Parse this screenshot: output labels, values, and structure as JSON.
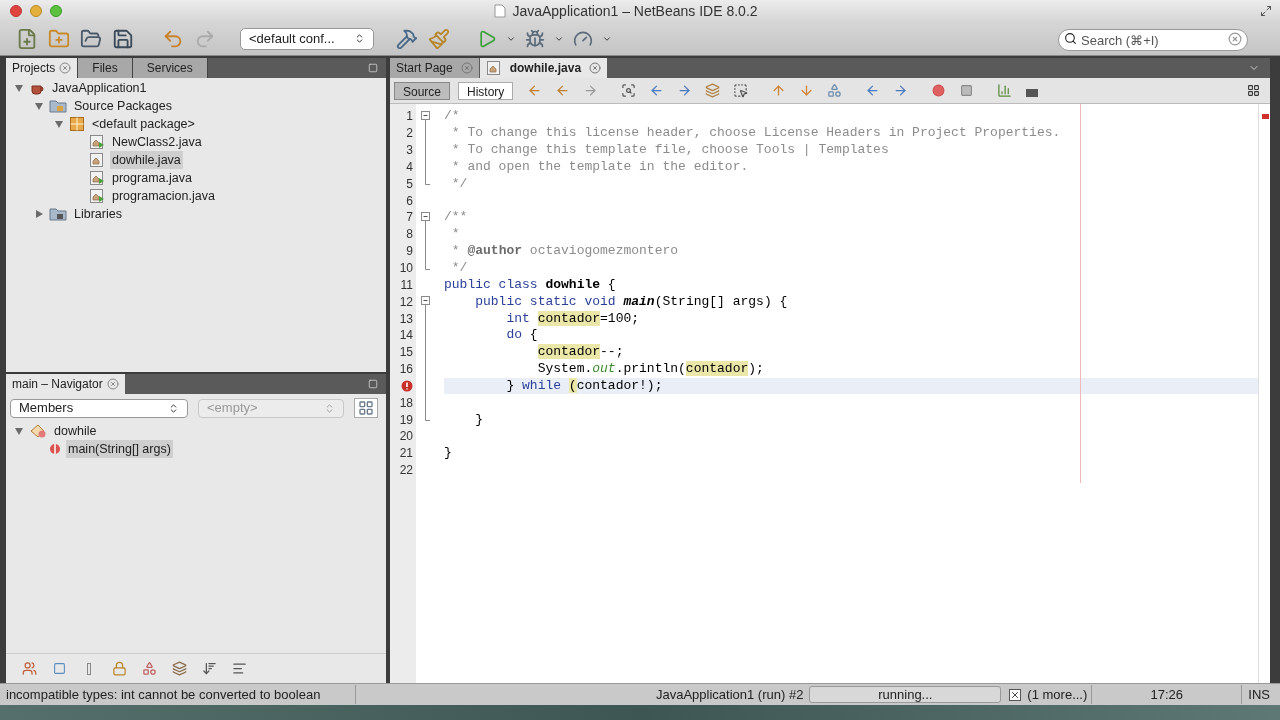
{
  "window": {
    "title": "JavaApplication1 – NetBeans IDE 8.0.2"
  },
  "toolbar": {
    "configuration": "<default conf...",
    "search": {
      "placeholder": "Search (⌘+I)"
    }
  },
  "projects": {
    "tabs": [
      {
        "label": "Projects",
        "selected": true,
        "closable": true
      },
      {
        "label": "Files",
        "selected": false,
        "closable": false
      },
      {
        "label": "Services",
        "selected": false,
        "closable": false
      }
    ],
    "tree": [
      {
        "label": "JavaApplication1",
        "kind": "project",
        "expanded": true,
        "selected": false,
        "children": [
          {
            "label": "Source Packages",
            "kind": "source",
            "expanded": true,
            "selected": false,
            "children": [
              {
                "label": "<default package>",
                "kind": "package",
                "expanded": true,
                "selected": false,
                "children": [
                  {
                    "label": "NewClass2.java",
                    "kind": "runnable",
                    "selected": false
                  },
                  {
                    "label": "dowhile.java",
                    "kind": "file",
                    "selected": true
                  },
                  {
                    "label": "programa.java",
                    "kind": "runnable",
                    "selected": false
                  },
                  {
                    "label": "programacion.java",
                    "kind": "runnable",
                    "selected": false
                  }
                ]
              }
            ]
          },
          {
            "label": "Libraries",
            "kind": "libraries",
            "expanded": false,
            "selected": false
          }
        ]
      }
    ]
  },
  "navigator": {
    "title": "main – Navigator",
    "filters": [
      {
        "label": "Members",
        "disabled": false
      },
      {
        "label": "<empty>",
        "disabled": true
      }
    ],
    "tree": [
      {
        "label": "dowhile",
        "kind": "class",
        "expanded": true,
        "selected": false,
        "children": [
          {
            "label": "main(String[] args)",
            "kind": "method",
            "selected": true
          }
        ]
      }
    ]
  },
  "editor": {
    "tabs": [
      {
        "label": "Start Page",
        "selected": false
      },
      {
        "label": "dowhile.java",
        "selected": true
      }
    ],
    "views": [
      {
        "label": "Source",
        "selected": true
      },
      {
        "label": "History",
        "selected": false
      }
    ],
    "lines": [
      {
        "number": "1",
        "kind": "start",
        "error": false,
        "current": false,
        "tokens": [
          {
            "kind": "comment",
            "text": "/*"
          }
        ]
      },
      {
        "number": "2",
        "kind": "body",
        "error": false,
        "current": false,
        "tokens": [
          {
            "kind": "comment",
            "text": " * To change this license header, choose License Headers in Project Properties."
          }
        ]
      },
      {
        "number": "3",
        "kind": "body",
        "error": false,
        "current": false,
        "tokens": [
          {
            "kind": "comment",
            "text": " * To change this template file, choose Tools | Templates"
          }
        ]
      },
      {
        "number": "4",
        "kind": "body",
        "error": false,
        "current": false,
        "tokens": [
          {
            "kind": "comment",
            "text": " * and open the template in the editor."
          }
        ]
      },
      {
        "number": "5",
        "kind": "end",
        "error": false,
        "current": false,
        "tokens": [
          {
            "kind": "comment",
            "text": " */"
          }
        ]
      },
      {
        "number": "6",
        "kind": "plain",
        "error": false,
        "current": false
      },
      {
        "number": "7",
        "kind": "start",
        "error": false,
        "current": false,
        "tokens": [
          {
            "kind": "comment",
            "text": "/**"
          }
        ]
      },
      {
        "number": "8",
        "kind": "body",
        "error": false,
        "current": false,
        "tokens": [
          {
            "kind": "comment",
            "text": " *"
          }
        ]
      },
      {
        "number": "9",
        "kind": "body",
        "error": false,
        "current": false,
        "tokens": [
          {
            "kind": "comment",
            "text": " * "
          },
          {
            "kind": "doc-tag",
            "text": "@author"
          },
          {
            "kind": "comment",
            "text": " octaviogomezmontero"
          }
        ]
      },
      {
        "number": "10",
        "kind": "end",
        "error": false,
        "current": false,
        "tokens": [
          {
            "kind": "comment",
            "text": " */"
          }
        ]
      },
      {
        "number": "11",
        "kind": "plain",
        "error": false,
        "current": false,
        "tokens": [
          {
            "kind": "keyword",
            "text": "public class "
          },
          {
            "kind": "declaration",
            "text": "dowhile"
          },
          {
            "kind": "plain",
            "text": " {"
          }
        ]
      },
      {
        "number": "12",
        "kind": "start",
        "error": false,
        "current": false,
        "tokens": [
          {
            "kind": "keyword",
            "text": "    public static void "
          },
          {
            "kind": "method",
            "text": "main"
          },
          {
            "kind": "plain",
            "text": "(String[] args) {"
          }
        ]
      },
      {
        "number": "13",
        "kind": "body",
        "error": false,
        "current": false,
        "tokens": [
          {
            "kind": "keyword",
            "text": "        int "
          },
          {
            "kind": "highlight",
            "text": "contador"
          },
          {
            "kind": "plain",
            "text": "=100;"
          }
        ]
      },
      {
        "number": "14",
        "kind": "body",
        "error": false,
        "current": false,
        "tokens": [
          {
            "kind": "keyword",
            "text": "        do"
          },
          {
            "kind": "plain",
            "text": " {"
          }
        ]
      },
      {
        "number": "15",
        "kind": "body",
        "error": false,
        "current": false,
        "tokens": [
          {
            "kind": "highlight",
            "text": "            contador"
          },
          {
            "kind": "plain",
            "text": "--;"
          }
        ]
      },
      {
        "number": "16",
        "kind": "body",
        "error": false,
        "current": false,
        "tokens": [
          {
            "kind": "plain",
            "text": "            System."
          },
          {
            "kind": "field",
            "text": "out"
          },
          {
            "kind": "plain",
            "text": ".println("
          },
          {
            "kind": "highlight",
            "text": "contador"
          },
          {
            "kind": "plain",
            "text": ");"
          }
        ]
      },
      {
        "kind": "body",
        "error": true,
        "current": true,
        "tokens": [
          {
            "kind": "plain",
            "text": "        } "
          },
          {
            "kind": "keyword",
            "text": "while "
          },
          {
            "kind": "highlight",
            "text": "("
          },
          {
            "kind": "plain",
            "text": "contador!);"
          }
        ]
      },
      {
        "number": "18",
        "kind": "body",
        "error": false,
        "current": false
      },
      {
        "number": "19",
        "kind": "end",
        "error": false,
        "current": false,
        "tokens": [
          {
            "kind": "plain",
            "text": "    }"
          }
        ]
      },
      {
        "number": "20",
        "kind": "plain",
        "error": false,
        "current": false
      },
      {
        "number": "21",
        "kind": "plain",
        "error": false,
        "current": false,
        "tokens": [
          {
            "kind": "plain",
            "text": "}"
          }
        ]
      },
      {
        "number": "22",
        "kind": "plain",
        "error": false,
        "current": false
      }
    ]
  },
  "status_bar": {
    "message": "incompatible types: int cannot be converted to boolean",
    "task": "JavaApplication1 (run) #2",
    "progress": "running...",
    "more": "(1 more...)",
    "position": "17:26",
    "mode": "INS"
  }
}
